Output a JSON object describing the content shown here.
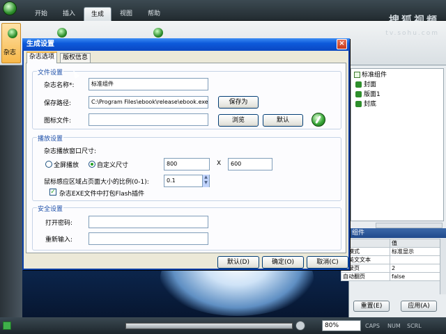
{
  "menubar": {
    "tabs": [
      {
        "label": "开始"
      },
      {
        "label": "插入"
      },
      {
        "label": "生成"
      },
      {
        "label": "视图"
      },
      {
        "label": "帮助"
      }
    ],
    "active_tab": "生成"
  },
  "ribbon": {
    "first_button_label": "杂志"
  },
  "watermark": {
    "brand": "搜狐视频",
    "url": "tv.sohu.com"
  },
  "dialog": {
    "title": "生成设置",
    "close_label": "×",
    "tabs": [
      {
        "label": "杂志选项"
      },
      {
        "label": "版权信息"
      }
    ],
    "file_section": {
      "title": "文件设置",
      "name_label": "杂志名称*:",
      "name_value": "标准组件",
      "path_label": "保存路径:",
      "path_value": "C:\\Program Files\\ebook\\release\\ebook.exe",
      "save_as_label": "保存为",
      "icon_label": "图标文件:",
      "icon_value": "",
      "browse_label": "浏览",
      "default_label": "默认"
    },
    "play_section": {
      "title": "播放设置",
      "window_size_label": "杂志播放窗口尺寸:",
      "fullscreen_label": "全屏播放",
      "custom_label": "自定义尺寸",
      "width_value": "800",
      "times_label": "X",
      "height_value": "600",
      "ratio_label": "鼠标感应区域占页面大小的比例(0-1):",
      "ratio_value": "0.1",
      "flash_label": "杂志EXE文件中打包Flash插件",
      "flash_checked": true,
      "fullscreen_selected": false,
      "custom_selected": true
    },
    "security_section": {
      "title": "安全设置",
      "open_pw_label": "打开密码:",
      "open_pw_value": "",
      "reenter_label": "重新输入:",
      "reenter_value": ""
    },
    "footer": {
      "default_btn": "默认(D)",
      "ok_btn": "确定(O)",
      "cancel_btn": "取消(C)"
    }
  },
  "right_panel": {
    "tree": [
      {
        "label": "标准组件",
        "kind": "root"
      },
      {
        "label": "封面",
        "kind": "page"
      },
      {
        "label": "版面1",
        "kind": "page"
      },
      {
        "label": "封底",
        "kind": "page"
      }
    ],
    "properties_title": "组件",
    "properties_headers": [
      "性",
      "值"
    ],
    "properties": [
      {
        "name": "码模式",
        "value": "标准显示"
      },
      {
        "name": "超英文文本",
        "value": ""
      },
      {
        "name": "目录页",
        "value": "2"
      },
      {
        "name": "自动翻页",
        "value": "false"
      }
    ],
    "reset_btn": "重置(E)",
    "apply_btn": "应用(A)"
  },
  "statusbar": {
    "zoom": "80%",
    "indicators": [
      "CAPS",
      "NUM",
      "SCRL"
    ]
  },
  "colors": {
    "title_bar": "#0a47c2",
    "group_title": "#1b4ea8",
    "accent_green": "#2e8f2c"
  }
}
